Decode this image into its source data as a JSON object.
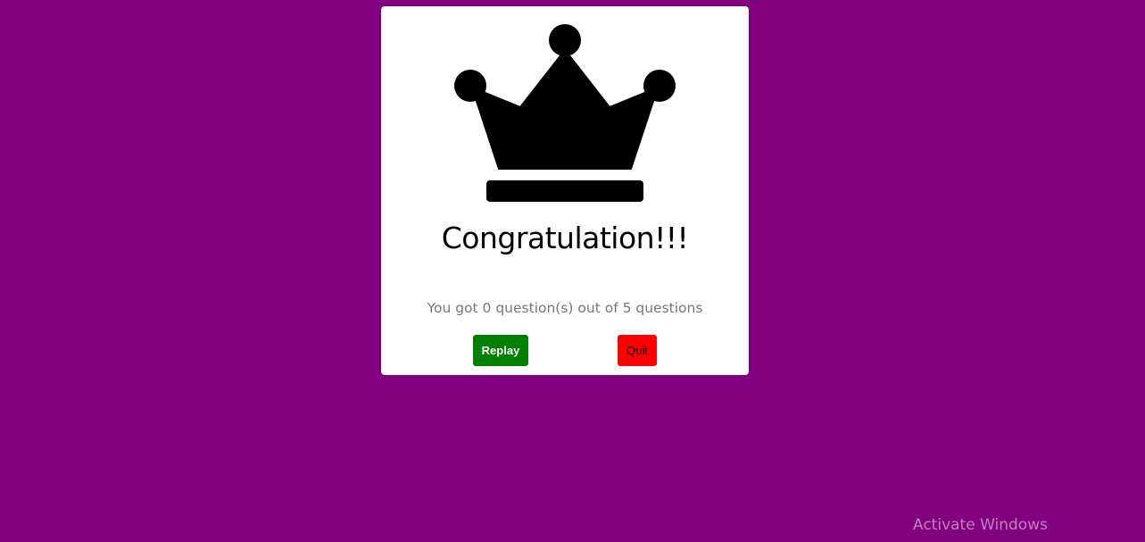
{
  "card": {
    "icon": "crown-icon",
    "title": "Congratulation!!!",
    "score_text": "You got 0 question(s) out of 5 questions"
  },
  "buttons": {
    "replay_label": "Replay",
    "quit_label": "Quit"
  },
  "watermark": {
    "text": "Activate Windows"
  },
  "colors": {
    "background": "#800080",
    "card": "#ffffff",
    "replay": "#008000",
    "quit": "#ff0000"
  }
}
